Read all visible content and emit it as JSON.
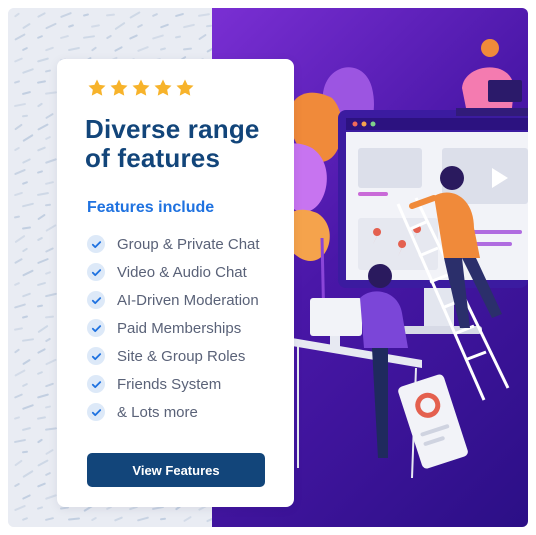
{
  "card": {
    "rating": {
      "stars": 5,
      "max": 5,
      "star_color": "#f7b32b"
    },
    "title_line1": "Diverse range",
    "title_line2": "of features",
    "subtitle": "Features include",
    "features": [
      "Group & Private Chat",
      "Video & Audio Chat",
      "AI-Driven Moderation",
      "Paid Memberships",
      "Site & Group Roles",
      "Friends System",
      "& Lots more"
    ],
    "cta_label": "View Features"
  },
  "colors": {
    "title": "#12457a",
    "subtitle": "#1f72e0",
    "check": "#1f72e0",
    "button": "#12457a",
    "hero_gradient_start": "#7a2fd3",
    "hero_gradient_end": "#2b0f86"
  },
  "illustration": {
    "description_icons": [
      "monitor-icon",
      "ladder-icon",
      "person-icon",
      "laptop-icon",
      "tablet-icon",
      "map-pin-icon",
      "play-icon"
    ]
  }
}
